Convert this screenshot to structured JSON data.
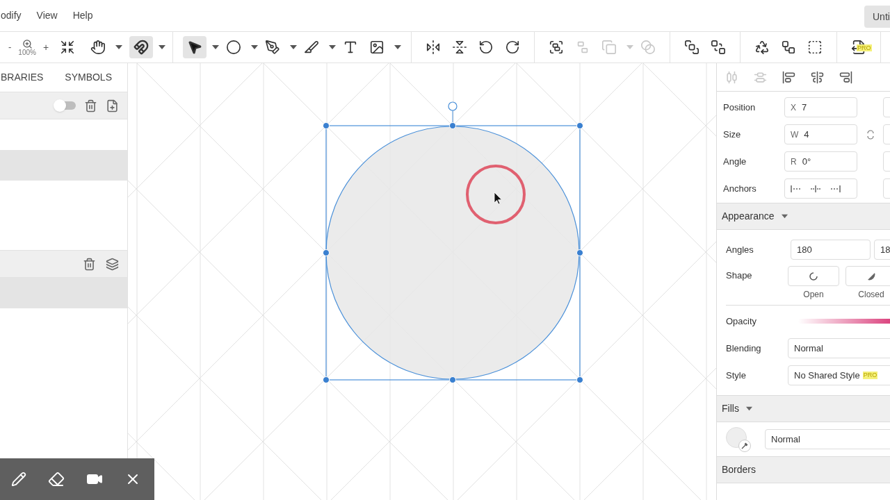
{
  "menu": [
    {
      "label": "odify"
    },
    {
      "label": "View"
    },
    {
      "label": "Help"
    }
  ],
  "document_button": "Unti",
  "zoom": {
    "out": "-",
    "level": "100%",
    "in": "+"
  },
  "tool_groups": [
    [
      {
        "selected": false,
        "disabled": false
      },
      {
        "selected": false,
        "disabled": false
      },
      {
        "selected": true,
        "disabled": false
      }
    ],
    [
      {
        "selected": true,
        "disabled": false
      },
      {
        "selected": false,
        "disabled": false
      },
      {
        "selected": false,
        "disabled": false
      },
      {
        "selected": false,
        "disabled": false
      },
      {
        "selected": false,
        "disabled": false
      },
      {
        "selected": false,
        "disabled": false
      }
    ],
    [
      {
        "selected": false,
        "disabled": false
      },
      {
        "selected": false,
        "disabled": false
      },
      {
        "selected": false,
        "disabled": false
      },
      {
        "selected": false,
        "disabled": false
      }
    ],
    [
      {
        "selected": false,
        "disabled": false
      },
      {
        "selected": false,
        "disabled": true
      },
      {
        "selected": false,
        "disabled": true
      },
      {
        "selected": false,
        "disabled": true
      }
    ],
    [
      {
        "selected": false,
        "disabled": false
      },
      {
        "selected": false,
        "disabled": false
      }
    ],
    [
      {
        "selected": false,
        "disabled": false
      },
      {
        "selected": false,
        "disabled": false
      },
      {
        "selected": false,
        "disabled": false
      }
    ],
    [
      {
        "selected": false,
        "disabled": false
      }
    ]
  ],
  "export_badge": "PRO",
  "left_tabs": [
    {
      "label": "BRARIES",
      "selected": false
    },
    {
      "label": "SYMBOLS",
      "selected": false
    }
  ],
  "pages_toggle": {
    "on": false
  },
  "pages": [
    {
      "selected": false
    },
    {
      "selected": true
    }
  ],
  "layers": [
    {
      "selected": true
    }
  ],
  "align_tools": [
    {
      "disabled": true
    },
    {
      "disabled": true
    },
    {
      "disabled": false
    },
    {
      "disabled": false
    },
    {
      "disabled": false
    }
  ],
  "transform": [
    {
      "kind": "pair",
      "label": "Position",
      "prefix": "X",
      "value": "7"
    },
    {
      "kind": "size",
      "label": "Size",
      "prefix": "W",
      "value": "4"
    },
    {
      "kind": "pair",
      "label": "Angle",
      "prefix": "R",
      "value": "0°"
    },
    {
      "kind": "anchors",
      "label": "Anchors"
    }
  ],
  "appearance": {
    "title": "Appearance",
    "expanded": true,
    "angles_label": "Angles",
    "angles": [
      "180",
      "18"
    ],
    "shape_label": "Shape",
    "shapes": [
      {
        "label": "Open"
      },
      {
        "label": "Closed"
      }
    ],
    "opacity_label": "Opacity",
    "opacity": {
      "level": 1
    },
    "blending_label": "Blending",
    "blending": "Normal",
    "style_label": "Style",
    "style": "No Shared Style",
    "style_badge": "PRO"
  },
  "fills": {
    "title": "Fills",
    "expanded": true,
    "blend": "Normal"
  },
  "borders": {
    "title": "Borders"
  }
}
